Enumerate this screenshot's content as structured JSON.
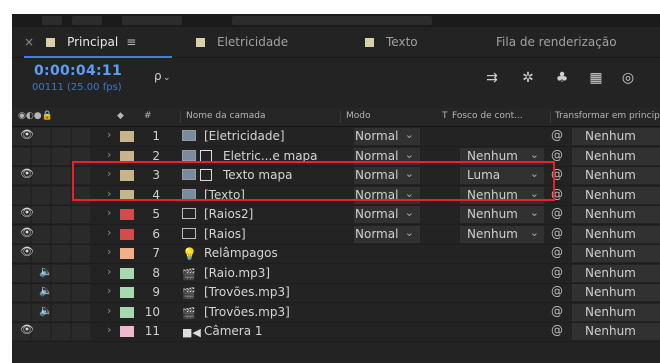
{
  "tabs": [
    {
      "label": "Principal",
      "swatch": "#d8d0a6",
      "active": true,
      "menu_glyph": "≡",
      "close_glyph": "×"
    },
    {
      "label": "Eletricidade",
      "swatch": "#d8d0a6",
      "active": false
    },
    {
      "label": "Texto",
      "swatch": "#d8d0a6",
      "active": false
    },
    {
      "label": "Fila de renderização",
      "active": false
    }
  ],
  "time": {
    "timecode": "0:00:04:11",
    "frames": "00111 (25.00 fps)"
  },
  "search": {
    "glyph": "ρ"
  },
  "toolbar": {
    "icons": [
      "comp-flowchart-icon",
      "draft-3d-icon",
      "shy-layers-icon",
      "frame-blending-icon",
      "motion-blur-icon"
    ]
  },
  "columns": {
    "switches_glyphs": "◉◐●🔒",
    "label_col": "#",
    "name": "Nome da camada",
    "mode": "Modo",
    "t": "T",
    "track": "Fosco de cont...",
    "parent": "Transformar em principal"
  },
  "layers": [
    {
      "num": "1",
      "name": "[Eletricidade]",
      "label_color": "#c8b48a",
      "type": "comp",
      "visible": true,
      "mode": "Normal",
      "track": "",
      "parent": "Nenhum"
    },
    {
      "num": "2",
      "name": "Eletric...e mapa",
      "label_color": "#c8b48a",
      "type": "comp-matte",
      "visible": false,
      "mode": "Normal",
      "track": "Nenhum",
      "parent": "Nenhum"
    },
    {
      "num": "3",
      "name": "Texto mapa",
      "label_color": "#c8b48a",
      "type": "comp-matte",
      "visible": true,
      "mode": "Normal",
      "track": "Luma",
      "parent": "Nenhum"
    },
    {
      "num": "4",
      "name": "[Texto]",
      "label_color": "#c8b48a",
      "type": "comp",
      "visible": false,
      "mode": "Normal",
      "track": "Nenhum",
      "parent": "Nenhum"
    },
    {
      "num": "5",
      "name": "[Raios2]",
      "label_color": "#d34b4b",
      "type": "solid",
      "visible": true,
      "mode": "Normal",
      "track": "Nenhum",
      "parent": "Nenhum"
    },
    {
      "num": "6",
      "name": "[Raios]",
      "label_color": "#d34b4b",
      "type": "solid",
      "visible": true,
      "mode": "Normal",
      "track": "Nenhum",
      "parent": "Nenhum"
    },
    {
      "num": "7",
      "name": "Relâmpagos",
      "label_color": "#f2b08a",
      "type": "light",
      "visible": true,
      "mode": "",
      "track": "",
      "parent": "Nenhum"
    },
    {
      "num": "8",
      "name": "[Raio.mp3]",
      "label_color": "#a8d8b0",
      "type": "audio",
      "visible": false,
      "mode": "",
      "track": "",
      "parent": "Nenhum"
    },
    {
      "num": "9",
      "name": "[Trovões.mp3]",
      "label_color": "#a8d8b0",
      "type": "audio",
      "visible": false,
      "mode": "",
      "track": "",
      "parent": "Nenhum"
    },
    {
      "num": "10",
      "name": "[Trovões.mp3]",
      "label_color": "#a8d8b0",
      "type": "audio",
      "visible": false,
      "mode": "",
      "track": "",
      "parent": "Nenhum"
    },
    {
      "num": "11",
      "name": "Câmera 1",
      "label_color": "#f0b8d0",
      "type": "camera",
      "visible": true,
      "mode": "",
      "track": "",
      "parent": "Nenhum"
    }
  ]
}
